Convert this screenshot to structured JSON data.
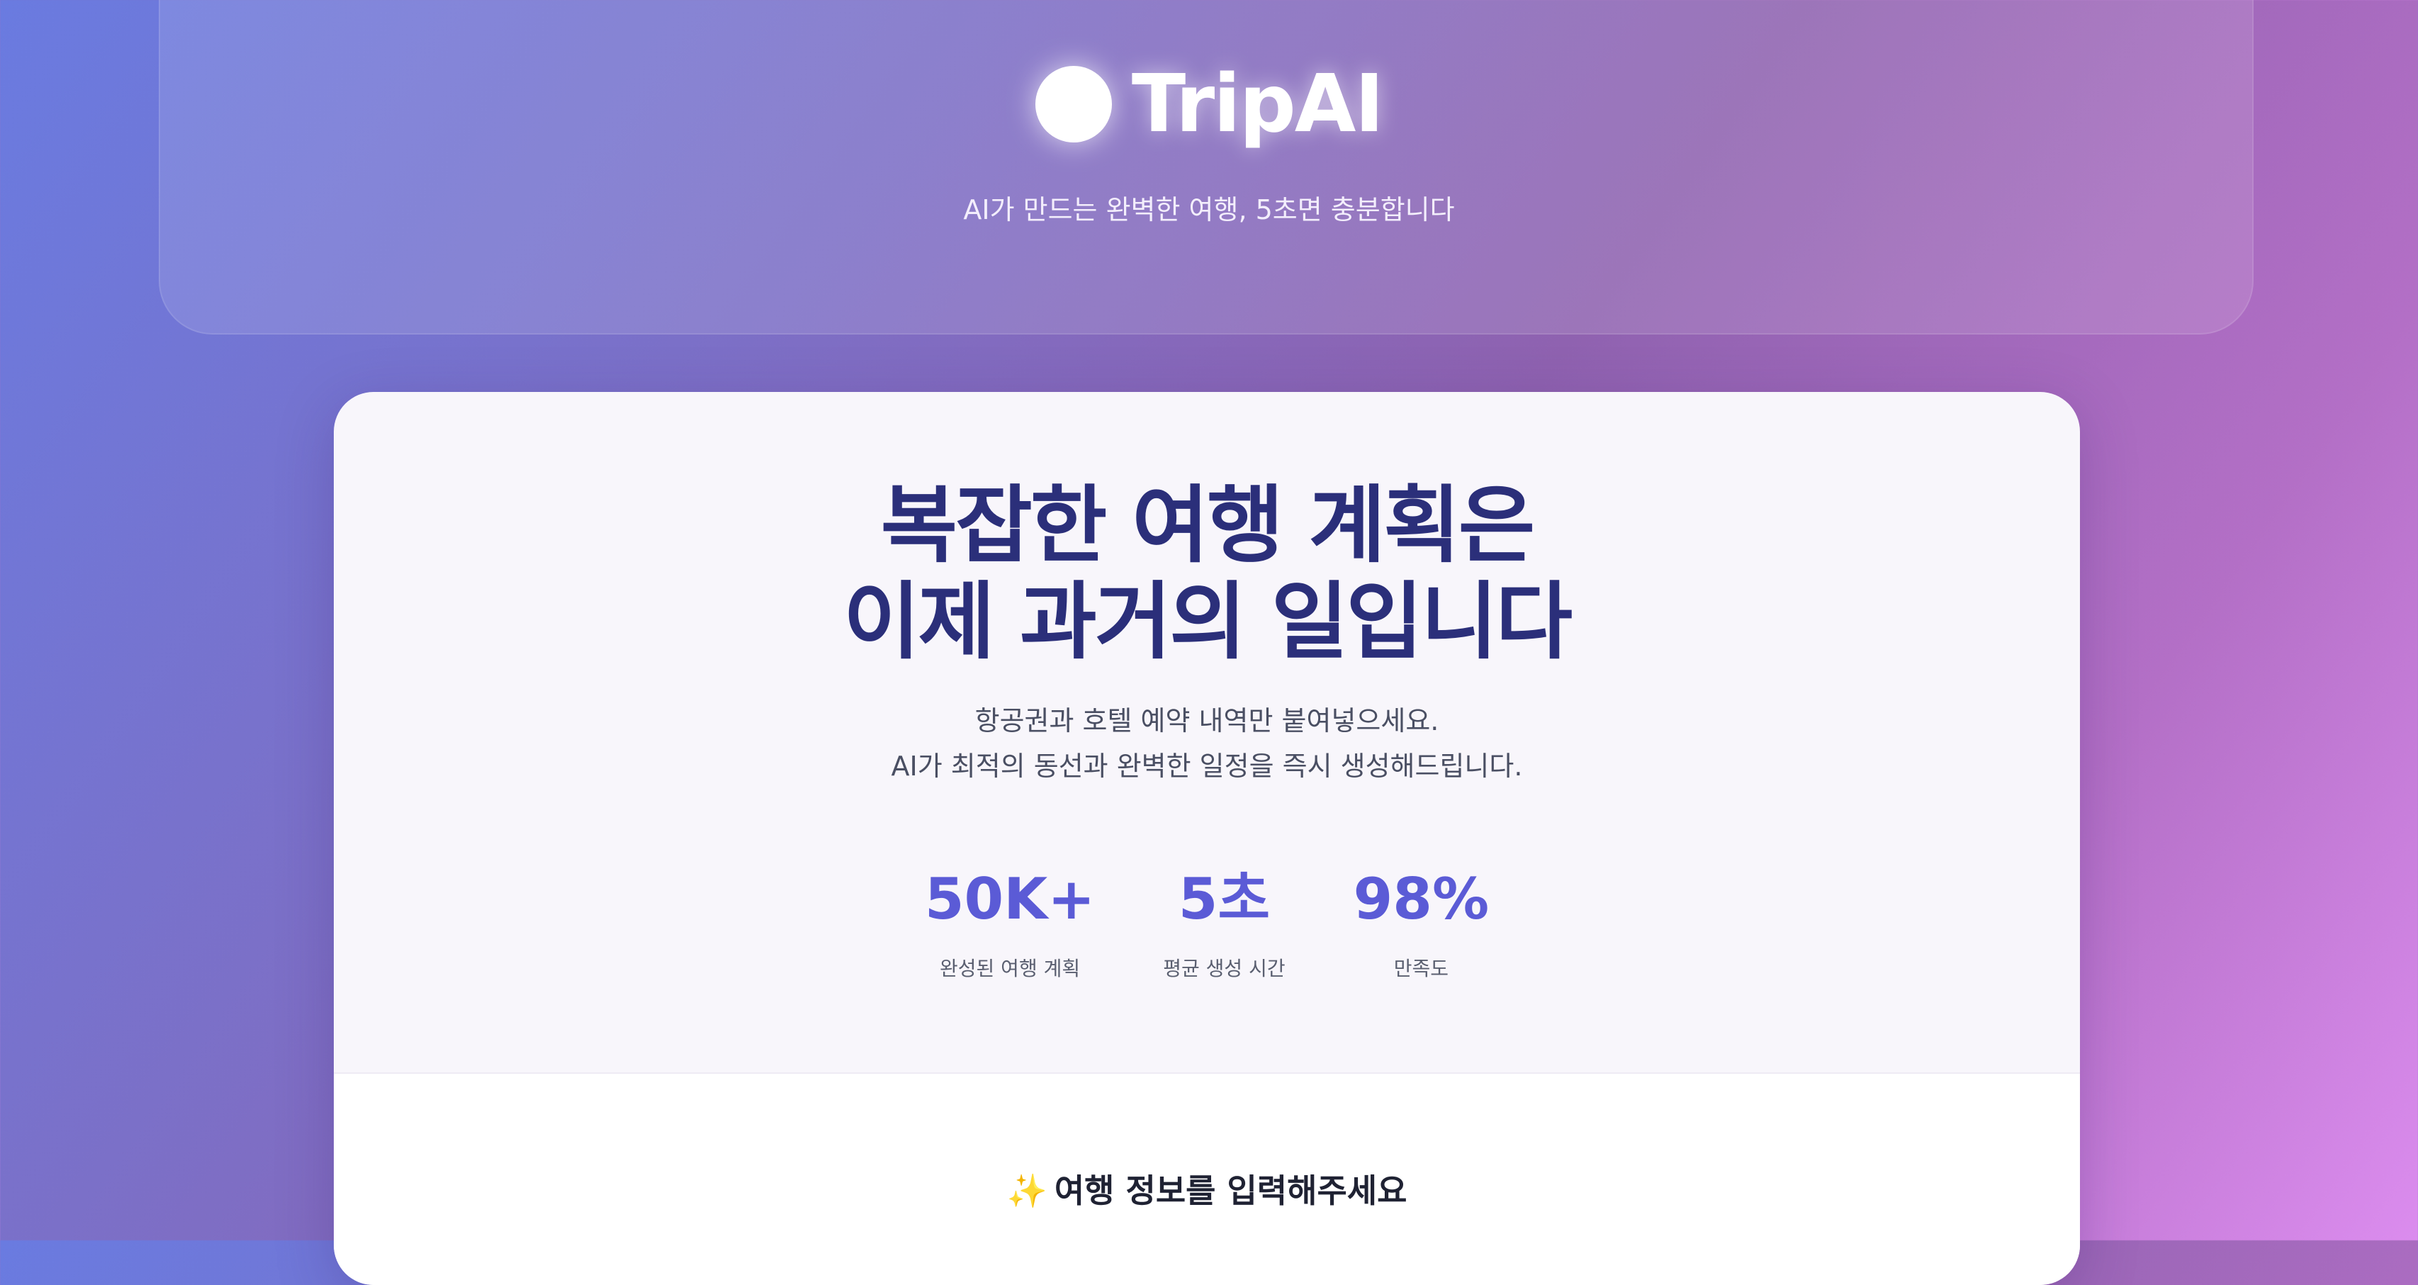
{
  "header": {
    "brand_name": "TripAI",
    "tagline": "AI가 만드는 완벽한 여행, 5초면 충분합니다"
  },
  "hero": {
    "title_line1": "복잡한 여행 계획은",
    "title_line2": "이제 과거의 일입니다",
    "subtitle_line1": "항공권과 호텔 예약 내역만 붙여넣으세요.",
    "subtitle_line2": "AI가 최적의 동선과 완벽한 일정을 즉시 생성해드립니다."
  },
  "stats": [
    {
      "value": "50K+",
      "label": "완성된 여행 계획"
    },
    {
      "value": "5초",
      "label": "평균 생성 시간"
    },
    {
      "value": "98%",
      "label": "만족도"
    }
  ],
  "form": {
    "title": "여행 정보를 입력해주세요",
    "title_icon": "sparkles-icon"
  },
  "colors": {
    "accent": "#5b5bd6",
    "title": "#2b2f7a",
    "background_start": "#6a7be0",
    "background_end": "#db8cee"
  }
}
